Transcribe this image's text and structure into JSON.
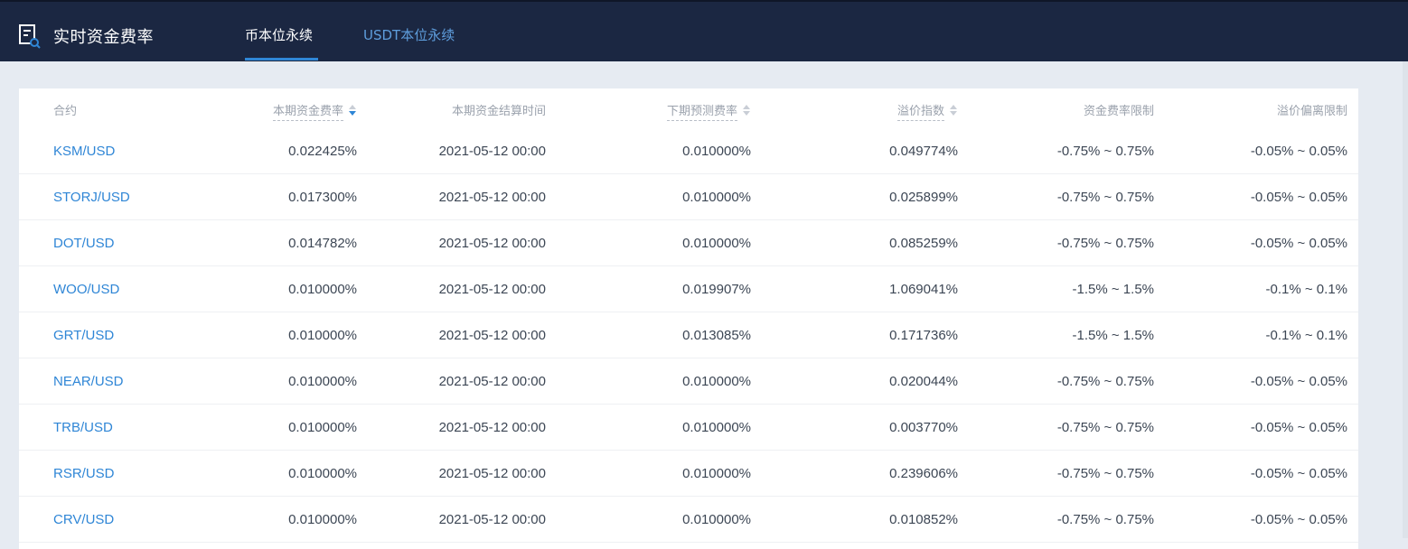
{
  "header": {
    "title": "实时资金费率",
    "tabs": [
      {
        "label": "币本位永续",
        "active": true
      },
      {
        "label": "USDT本位永续",
        "active": false
      }
    ]
  },
  "table": {
    "columns": {
      "contract": "合约",
      "current_rate": "本期资金费率",
      "settle_time": "本期资金结算时间",
      "next_rate": "下期预测费率",
      "premium_index": "溢价指数",
      "rate_limit": "资金费率限制",
      "premium_limit": "溢价偏离限制"
    },
    "rows": [
      {
        "symbol": "KSM/USD",
        "current_rate": "0.022425%",
        "settle_time": "2021-05-12 00:00",
        "next_rate": "0.010000%",
        "premium_index": "0.049774%",
        "rate_limit": "-0.75% ~ 0.75%",
        "premium_limit": "-0.05% ~ 0.05%"
      },
      {
        "symbol": "STORJ/USD",
        "current_rate": "0.017300%",
        "settle_time": "2021-05-12 00:00",
        "next_rate": "0.010000%",
        "premium_index": "0.025899%",
        "rate_limit": "-0.75% ~ 0.75%",
        "premium_limit": "-0.05% ~ 0.05%"
      },
      {
        "symbol": "DOT/USD",
        "current_rate": "0.014782%",
        "settle_time": "2021-05-12 00:00",
        "next_rate": "0.010000%",
        "premium_index": "0.085259%",
        "rate_limit": "-0.75% ~ 0.75%",
        "premium_limit": "-0.05% ~ 0.05%"
      },
      {
        "symbol": "WOO/USD",
        "current_rate": "0.010000%",
        "settle_time": "2021-05-12 00:00",
        "next_rate": "0.019907%",
        "premium_index": "1.069041%",
        "rate_limit": "-1.5% ~ 1.5%",
        "premium_limit": "-0.1% ~ 0.1%"
      },
      {
        "symbol": "GRT/USD",
        "current_rate": "0.010000%",
        "settle_time": "2021-05-12 00:00",
        "next_rate": "0.013085%",
        "premium_index": "0.171736%",
        "rate_limit": "-1.5% ~ 1.5%",
        "premium_limit": "-0.1% ~ 0.1%"
      },
      {
        "symbol": "NEAR/USD",
        "current_rate": "0.010000%",
        "settle_time": "2021-05-12 00:00",
        "next_rate": "0.010000%",
        "premium_index": "0.020044%",
        "rate_limit": "-0.75% ~ 0.75%",
        "premium_limit": "-0.05% ~ 0.05%"
      },
      {
        "symbol": "TRB/USD",
        "current_rate": "0.010000%",
        "settle_time": "2021-05-12 00:00",
        "next_rate": "0.010000%",
        "premium_index": "0.003770%",
        "rate_limit": "-0.75% ~ 0.75%",
        "premium_limit": "-0.05% ~ 0.05%"
      },
      {
        "symbol": "RSR/USD",
        "current_rate": "0.010000%",
        "settle_time": "2021-05-12 00:00",
        "next_rate": "0.010000%",
        "premium_index": "0.239606%",
        "rate_limit": "-0.75% ~ 0.75%",
        "premium_limit": "-0.05% ~ 0.05%"
      },
      {
        "symbol": "CRV/USD",
        "current_rate": "0.010000%",
        "settle_time": "2021-05-12 00:00",
        "next_rate": "0.010000%",
        "premium_index": "0.010852%",
        "rate_limit": "-0.75% ~ 0.75%",
        "premium_limit": "-0.05% ~ 0.05%"
      }
    ]
  },
  "colors": {
    "header_bg": "#1b2742",
    "accent": "#2f86d6",
    "page_bg": "#e6ebf2",
    "text": "#3c4654",
    "header_text": "#9aa1ac"
  },
  "icons": {
    "brand": "document-search-icon",
    "sort": "sort-caret-icon"
  }
}
